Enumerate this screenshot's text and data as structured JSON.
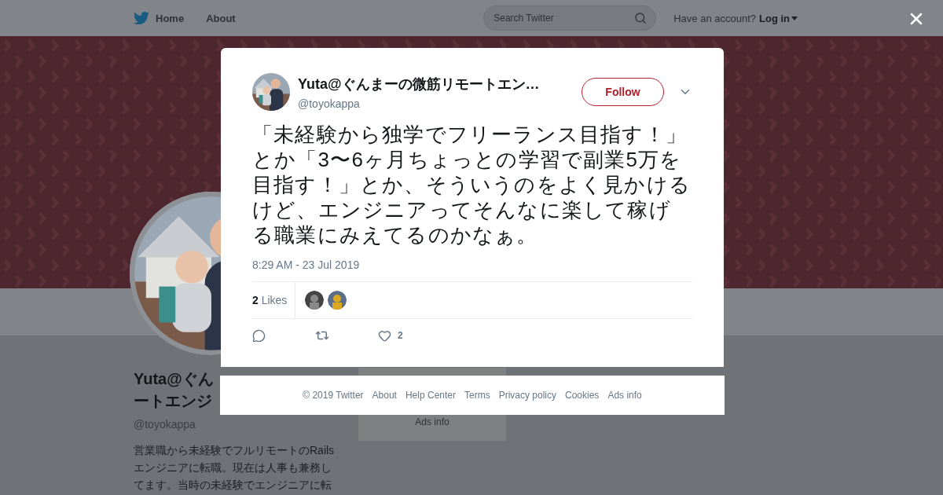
{
  "top_bar": {
    "nav": [
      "Home",
      "About"
    ],
    "search": {
      "placeholder": "Search Twitter"
    },
    "account_prompt": "Have an account?",
    "login": "Log in"
  },
  "profile": {
    "name_lines": [
      "Yuta@ぐん",
      "ートエンジ"
    ],
    "handle": "@toyokappa",
    "bio_lines": [
      "営業職から未経験でフルリモートのRails",
      "エンジニアに転職。現在は人事も兼務し",
      "てます。当時の未経験でエンジニアに転"
    ]
  },
  "sidebar": {
    "link": "Ads info"
  },
  "tweet": {
    "author": "Yuta@ぐんまーの微筋リモートエン…",
    "handle": "@toyokappa",
    "follow": "Follow",
    "text": "「未経験から独学でフリーランス目指す！」とか「3〜6ヶ月ちょっとの学習で副業5万を目指す！」とか、そういうのをよく見かけるけど、エンジニアってそんなに楽して稼げる職業にみえてるのかなぁ。",
    "timestamp": "8:29 AM - 23 Jul 2019",
    "likes_count": "2",
    "likes_label": "Likes",
    "actions": [
      {
        "kind": "reply"
      },
      {
        "kind": "retweet"
      },
      {
        "kind": "like",
        "count": "2"
      }
    ]
  },
  "footer": [
    "© 2019 Twitter",
    "About",
    "Help Center",
    "Terms",
    "Privacy policy",
    "Cookies",
    "Ads info"
  ]
}
